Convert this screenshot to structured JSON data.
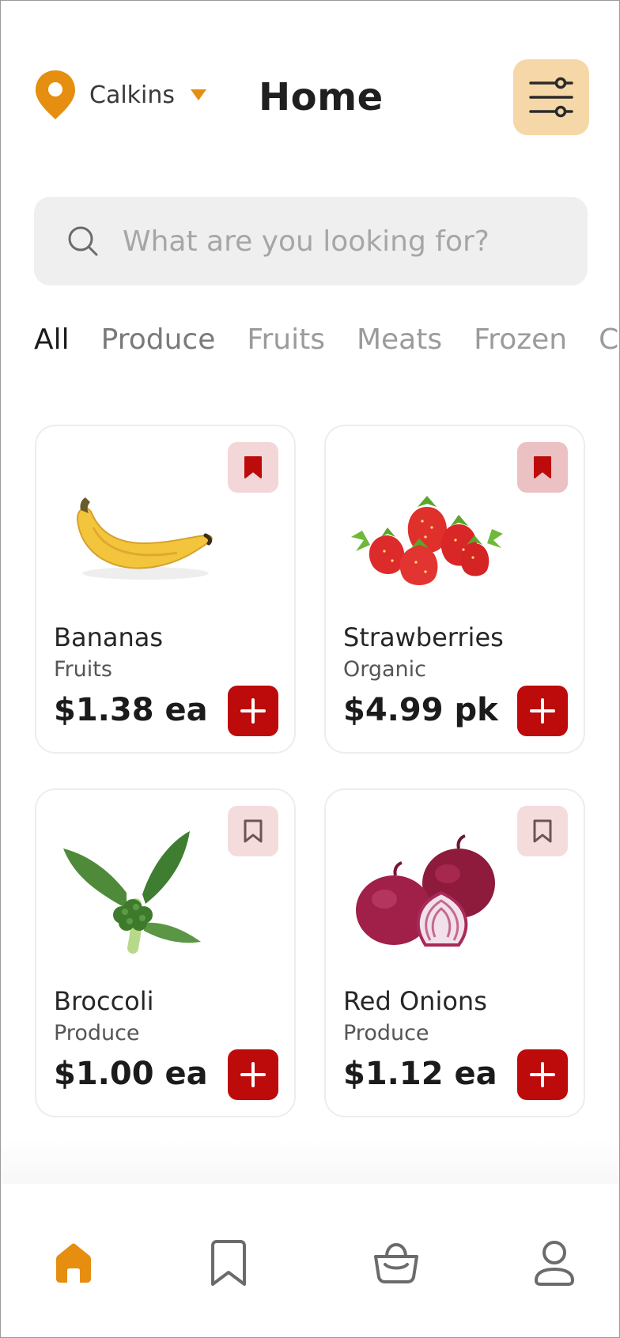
{
  "header": {
    "location": "Calkins",
    "title": "Home",
    "location_icon": "map-pin-icon",
    "filter_icon": "sliders-icon"
  },
  "search": {
    "placeholder": "What are you looking for?",
    "value": ""
  },
  "categories": [
    "All",
    "Produce",
    "Fruits",
    "Meats",
    "Frozen",
    "C"
  ],
  "products": [
    {
      "name": "Bananas",
      "category": "Fruits",
      "price": "$1.38 ea",
      "saved": true
    },
    {
      "name": "Strawberries",
      "category": "Organic",
      "price": "$4.99 pk",
      "saved": true
    },
    {
      "name": "Broccoli",
      "category": "Produce",
      "price": "$1.00 ea",
      "saved": false
    },
    {
      "name": "Red Onions",
      "category": "Produce",
      "price": "$1.12 ea",
      "saved": false
    }
  ],
  "bottom_nav": {
    "items": [
      "home-icon",
      "bookmark-icon",
      "basket-icon",
      "profile-icon"
    ],
    "active": "home-icon"
  },
  "colors": {
    "accent": "#e58e0f",
    "filter_bg": "#f6d7a7",
    "primary_red": "#bd0a0a",
    "bookmark_bg": "#f3d7d8",
    "search_bg": "#efefef"
  }
}
